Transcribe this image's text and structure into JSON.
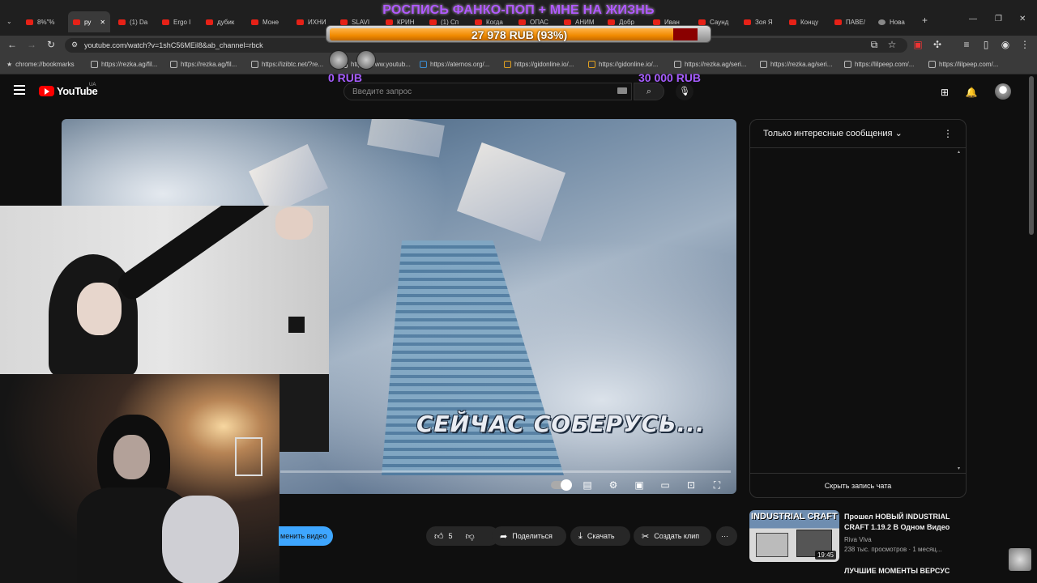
{
  "browser": {
    "tabs": [
      {
        "label": "8%\"%"
      },
      {
        "label": "ру"
      },
      {
        "label": "(1) Da"
      },
      {
        "label": "Ergo I"
      },
      {
        "label": "дубик"
      },
      {
        "label": "Моне"
      },
      {
        "label": "ИХНИ"
      },
      {
        "label": "SLAVI"
      },
      {
        "label": "КРИН"
      },
      {
        "label": "(1) Сп"
      },
      {
        "label": "Когда"
      },
      {
        "label": "ОПАС"
      },
      {
        "label": "АНИМ"
      },
      {
        "label": "Добр"
      },
      {
        "label": "Иван"
      },
      {
        "label": "Саунд"
      },
      {
        "label": "Зоя Я"
      },
      {
        "label": "Концу"
      },
      {
        "label": "ПАВЕ/"
      },
      {
        "label": "Нова"
      }
    ],
    "url": "youtube.com/watch?v=1shC56MEil8&ab_channel=rbck",
    "bookmarks": [
      "chrome://bookmarks",
      "https://rezka.ag/fil...",
      "https://rezka.ag/fil...",
      "https://izibtc.net/?re...",
      "https://www.youtub...",
      "https://aternos.org/...",
      "https://gidonline.io/...",
      "https://gidonline.io/...",
      "https://rezka.ag/seri...",
      "https://rezka.ag/seri...",
      "https://lilpeep.com/...",
      "https://lilpeep.com/..."
    ]
  },
  "donation": {
    "title": "РОСПИСЬ ФАНКО-ПОП + МНЕ НА ЖИЗНЬ",
    "amount": "27 978 RUB (93%)",
    "progress": 0.93,
    "min_label": "0 RUB",
    "max_label": "30 000 RUB"
  },
  "youtube": {
    "logo_text": "YouTube",
    "region": "UA",
    "search_placeholder": "Введите запрос"
  },
  "video": {
    "caption": "СЕЙЧАС СОБЕРУСЬ..."
  },
  "actions": {
    "subscribe_partial": "менить видео",
    "likes": "5",
    "share": "Поделиться",
    "download": "Скачать",
    "clip": "Создать клип",
    "more": "···"
  },
  "chat": {
    "title": "Только интересные сообщения",
    "hide": "Скрыть запись чата"
  },
  "recommended": {
    "thumb_title": "INDUSTRIAL CRAFT",
    "duration": "19:45",
    "title": "Прошел НОВЫЙ INDUSTRIAL CRAFT 1.19.2 В Одном Видео",
    "channel": "Riva Viva",
    "meta": "238 тыс. просмотров · 1 месяц...",
    "next_title": "ЛУЧШИЕ МОМЕНТЫ ВЕРСУС"
  },
  "colors": {
    "accent": "#3ea6ff",
    "yt_red": "#ff0000",
    "donation_fill": "#f08a00",
    "donation_text": "#b15cff"
  }
}
